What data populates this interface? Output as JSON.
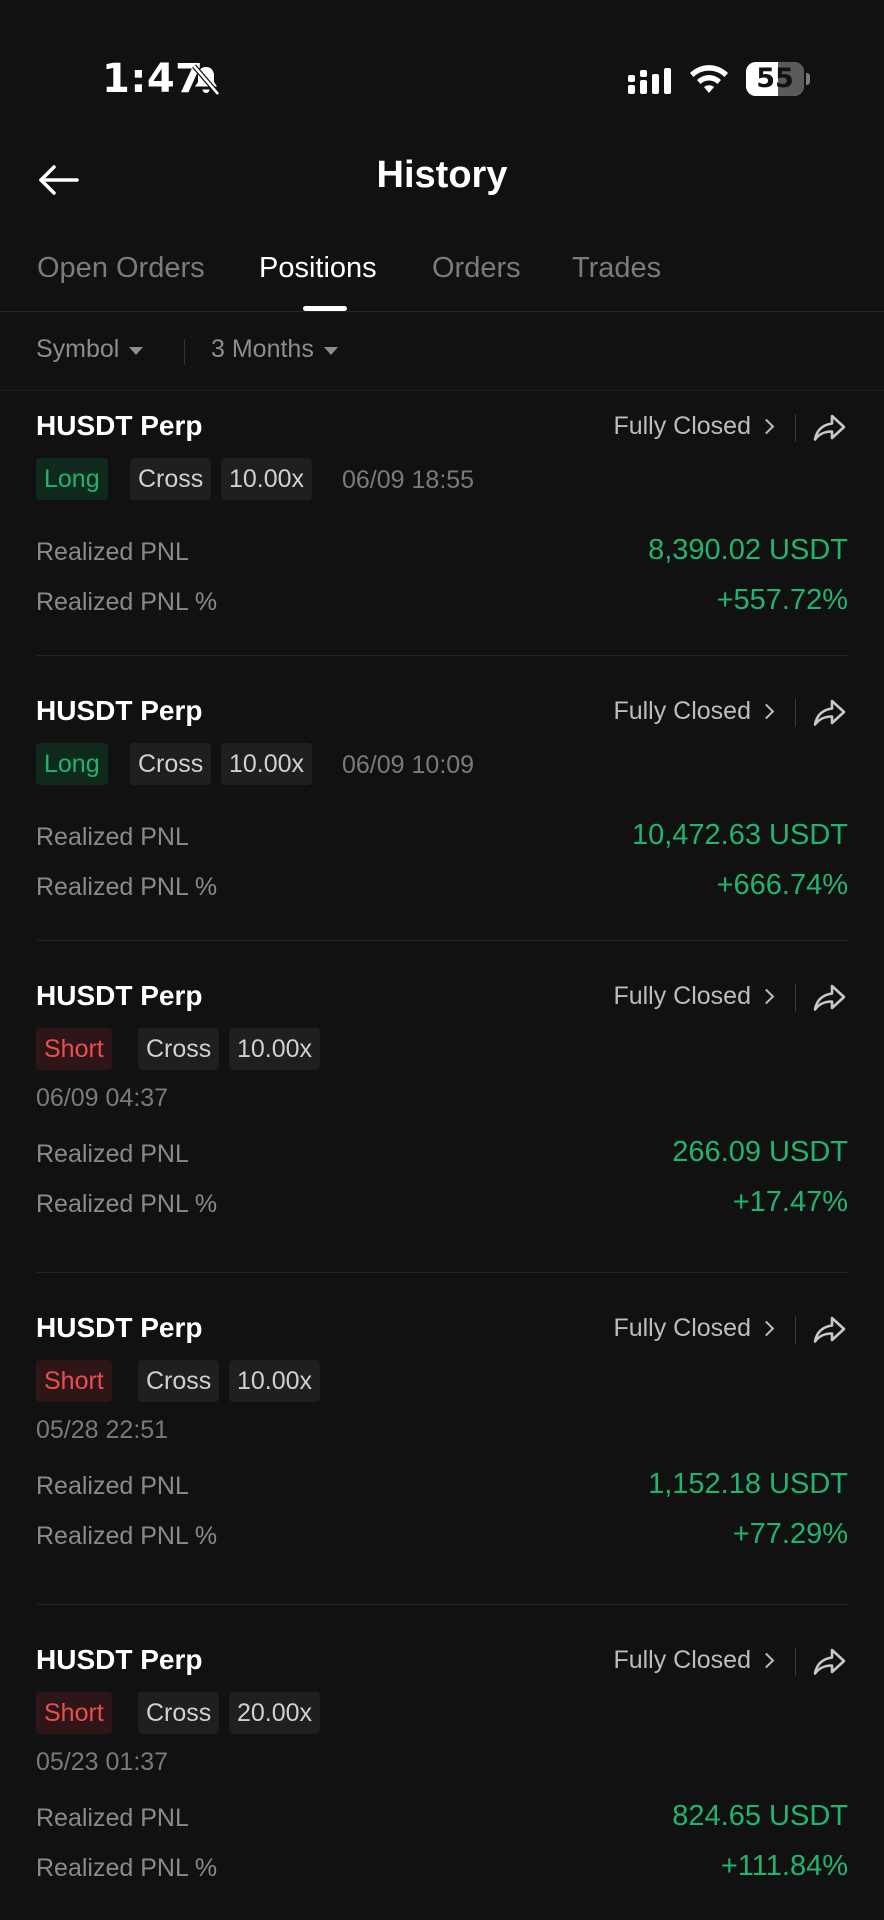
{
  "status_bar": {
    "time": "1:47",
    "battery": "55",
    "battery_level": 0.55
  },
  "header": {
    "title": "History"
  },
  "tabs": [
    {
      "label": "Open Orders",
      "active": false
    },
    {
      "label": "Positions",
      "active": true
    },
    {
      "label": "Orders",
      "active": false
    },
    {
      "label": "Trades",
      "active": false
    }
  ],
  "filters": {
    "symbol": "Symbol",
    "period": "3 Months"
  },
  "labels": {
    "pnl": "Realized PNL",
    "pnl_pct": "Realized PNL %"
  },
  "positions": [
    {
      "symbol": "HUSDT Perp",
      "status": "Fully Closed",
      "side": "Long",
      "margin": "Cross",
      "leverage": "10.00x",
      "time": "06/09 18:55",
      "pnl": "8,390.02 USDT",
      "pnl_pct": "+557.72%"
    },
    {
      "symbol": "HUSDT Perp",
      "status": "Fully Closed",
      "side": "Long",
      "margin": "Cross",
      "leverage": "10.00x",
      "time": "06/09 10:09",
      "pnl": "10,472.63 USDT",
      "pnl_pct": "+666.74%"
    },
    {
      "symbol": "HUSDT Perp",
      "status": "Fully Closed",
      "side": "Short",
      "margin": "Cross",
      "leverage": "10.00x",
      "time": "06/09 04:37",
      "pnl": "266.09 USDT",
      "pnl_pct": "+17.47%"
    },
    {
      "symbol": "HUSDT Perp",
      "status": "Fully Closed",
      "side": "Short",
      "margin": "Cross",
      "leverage": "10.00x",
      "time": "05/28 22:51",
      "pnl": "1,152.18 USDT",
      "pnl_pct": "+77.29%"
    },
    {
      "symbol": "HUSDT Perp",
      "status": "Fully Closed",
      "side": "Short",
      "margin": "Cross",
      "leverage": "20.00x",
      "time": "05/23 01:37",
      "pnl": "824.65 USDT",
      "pnl_pct": "+111.84%"
    }
  ]
}
